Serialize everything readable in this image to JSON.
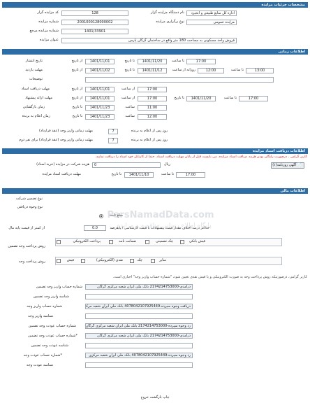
{
  "sections": {
    "details": "مشخصات جزئیات مزایده",
    "time": "اطلاعات زمانی",
    "docs": "اطلاعات دریافت اسناد مزایده",
    "finance": "اطلاعات مالی"
  },
  "details": {
    "org_code_label": "کد مزایده گزار",
    "org_code": "128",
    "org_name_label": "نام دستگاه مزایده گزار",
    "org_name": "اداره کل منابع طبیعی و ابخیزد",
    "auction_number_label": "شماره مزایده",
    "auction_number": "2001000128000002",
    "holding_type_label": "نوع برگزاری مزایده",
    "holding_type": "مزایده عمومی",
    "reference_number_label": "شماره مزایده مرجع",
    "reference_number": "1401/33901",
    "title_label": "عنوان مزایده",
    "title": "فروش واحد مسکونی به مساحت 180 متر واقع در ساختمان گرگان پارس"
  },
  "time": {
    "from_date": "از تاریخ",
    "to_date": "تا تاریخ",
    "from_time": "از ساعت",
    "to_time": "تا ساعت",
    "time_label": "ساعت",
    "daily_visit": "روزانه از ساعت",
    "publish_label": "تاریخ انتشار",
    "publish_from": "1401/11/01",
    "publish_to": "1401/11/20",
    "publish_time": "17:00",
    "visit_label": "مهلت بازدید",
    "visit_from": "1401/11/02",
    "visit_to": "1401/11/12",
    "visit_from_time": "12:00",
    "visit_to_time": "13:00",
    "desc_label": "توضیحات",
    "doc_receive_label": "مهلت دریافت اسناد",
    "doc_receive_from": "1401/11/01",
    "doc_receive_time": "17:00",
    "offer_label": "مهلت ارائه پیشنهاد",
    "offer_from": "1401/11/01",
    "offer_from_time": "17:00",
    "offer_to": "1401/11/20",
    "offer_to_time": "17:00",
    "opening_label": "زمان بازگشایی",
    "opening_date": "1401/11/23",
    "opening_time": "11:00",
    "announce_label": "زمان اعلام به برنده",
    "announce_date": "1401/11/23",
    "announce_time": "12:00",
    "deposit_deadline_label": "مهلت زمانی واریز وجه (عقد قرارداد)",
    "deposit_deadline_value": "7",
    "deposit_deadline_suffix": "روز پس از اعلام به برنده",
    "second_deadline_label": "مهلت زمانی واریز وجه (عقد قرارداد) برای نفر دوم",
    "second_deadline_value": "7",
    "second_deadline_suffix": "روز پس از اعلام به برنده"
  },
  "docs": {
    "notice": "کاربر گرامی ، درصورت رایگان بودن هزینه دریافت اسناد مزایده، می بایست قبل از پایان مهلت دریافت اسناد، حتما از کارتابل خود اسناد را دریافت نمایید.",
    "fee_label": "هزینه شرکت در مزایده (خرید اسناد)",
    "fee_value": "0",
    "fee_unit": "ریال",
    "deadline_label": "مهلت دریافت اسناد مزایده",
    "deadline_to_date": "تا تاریخ",
    "deadline_date": "1401/11/10",
    "deadline_to_time": "تا ساعت",
    "deadline_time": "17:00",
    "notice_file": "آگهی روزنامه(۱)"
  },
  "finance": {
    "guarantee_type_label": "نوع تضمین شرکت",
    "guarantee_receive_label": "نوع وجوه دریافتی",
    "fixed_amount_label": "مبلغ ثابت",
    "min_price_label": "از کمتر از قیمت پایه مال",
    "percent_value": "0.0",
    "percent_label": "درصد",
    "max_price_diff_label": "حداکثر درصد اختلاف مقدار قیمت پیشنهادات با قیمت کارشناسی / پایه",
    "deposit_method_label": "روش پرداخت وجه تضمین",
    "method_electronic": "پرداخت الکترونیکی",
    "method_bank_guarantee": "ضمانت نامه",
    "method_bank_check": "چک تضمینی",
    "method_receipt": "فیش بانکی",
    "payment_method_label": "روش پرداخت وجه",
    "pay_receipt": "فیش",
    "pay_cash": "نقدی (الکترونیکی)",
    "pay_check": "چک",
    "pay_other": "سایر",
    "bank_notice": "کاربر گرامی، درصورتیکه روش پرداخت وجه به صورت الکترونیکی و یا فیش نقدی تعیین شود، \"شماره حساب واریز وجه\" اجباری است.",
    "deposit_account_label": "شماره حساب واریز وجه تضمین",
    "deposit_account": "درآمدی-2174214753000 بانک ملی ایران شعبه مرکزی گرگان",
    "deposit_id_label": "شناسه واریز وجه تضمین",
    "deposit_id": "",
    "deposit_account2_label": "شماره حساب واریز وجه",
    "deposit_account2": "دریافت وجوه سپرده-4078042107925449 بانک ملی ایران شعبه مرکزی",
    "deposit_id2_label": "شناسه واریز وجه",
    "deposit_id2": "",
    "return_account_label": "شماره حساب عودت وجه تضمین",
    "return_account": "رد وجوه سپرده-2174214753000 بانک ملی ایران شعبه مرکزی گرگان",
    "return_account2_label": "*شماره حساب عودت وجه تضمین",
    "return_account2": "درآمدی-2174214753000 بانک ملی ایران شعبه مرکزی گرگان",
    "return_id_label": "شناسه عودت وجه تضمین",
    "return_id": "",
    "return_account3_label": "*شماره حساب عودت وجه",
    "return_account3": "رد وجوه سپرده-4078042107925449 بانک ملی ایران شعبه مرکزی",
    "return_id3_label": "شناسه عودت وجه",
    "return_id3": ""
  },
  "watermark": {
    "line1": "ParsNamadData.com",
    "line2": "پایگاه اطلاع رسانی مناقصه و مزایده"
  },
  "footer": {
    "print": "چاپ",
    "back": "بازگشت",
    "exit": "خروج"
  }
}
